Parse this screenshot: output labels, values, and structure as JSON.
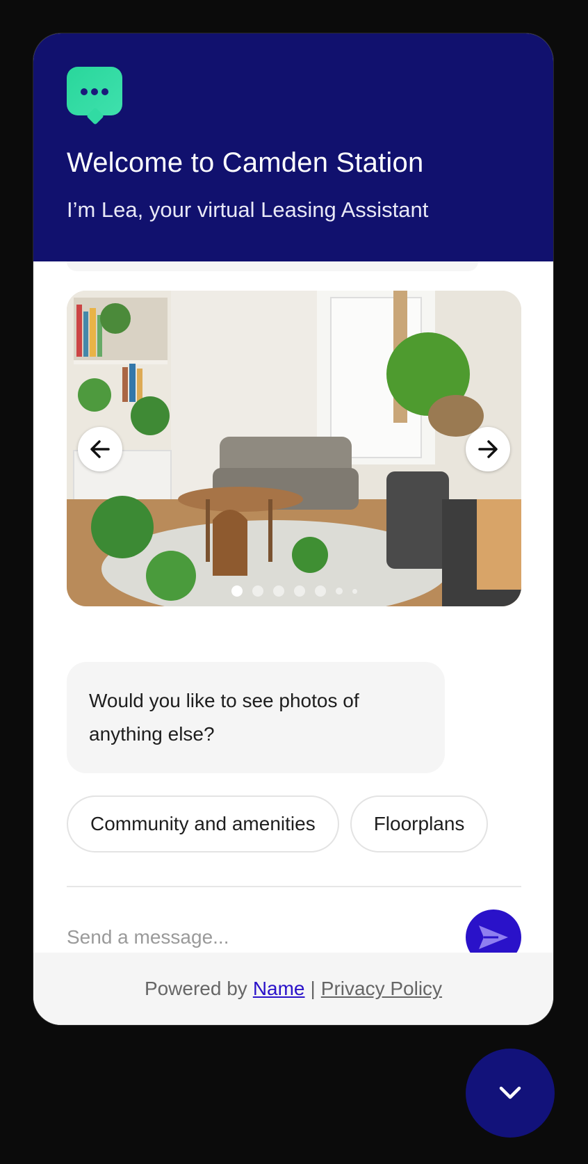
{
  "header": {
    "title": "Welcome to Camden Station",
    "subtitle": "I’m Lea, your virtual Leasing Assistant",
    "logo_icon": "chat-bubble-icon"
  },
  "carousel": {
    "prev_icon": "arrow-left-icon",
    "next_icon": "arrow-right-icon",
    "slide_count": 7,
    "active_index": 0
  },
  "bot_message": {
    "text": "Would you like to see photos of anything else?"
  },
  "quick_replies": [
    {
      "label": "Community and amenities"
    },
    {
      "label": "Floorplans"
    }
  ],
  "composer": {
    "placeholder": "Send a message...",
    "send_icon": "send-icon"
  },
  "footer": {
    "powered_by": "Powered by",
    "brand_link": "Name",
    "separator": "|",
    "privacy_link": "Privacy Policy"
  },
  "toggle": {
    "icon": "chevron-down-icon"
  },
  "colors": {
    "header_bg": "#11116e",
    "accent": "#2a12c9",
    "logo": "#2fd9a0"
  }
}
